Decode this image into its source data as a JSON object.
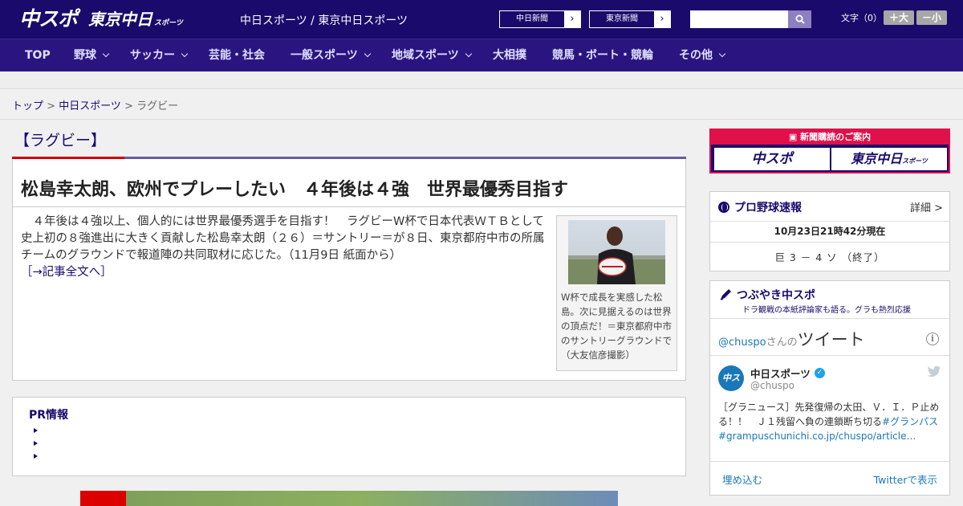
{
  "header": {
    "logo_chuspo": "中スポ",
    "logo_tokyo": "東京中日",
    "logo_tokyo_small": "スポーツ",
    "site_title": "中日スポーツ / 東京中日スポーツ",
    "paper_buttons": [
      {
        "label": "中日新聞",
        "arrow": "›"
      },
      {
        "label": "東京新聞",
        "arrow": "›"
      }
    ],
    "search_placeholder": "",
    "font_size_label": "文字（0）",
    "font_larger": "＋大",
    "font_smaller": "－小"
  },
  "nav": {
    "items": [
      {
        "label": "TOP",
        "dropdown": false
      },
      {
        "label": "野球",
        "dropdown": true
      },
      {
        "label": "サッカー",
        "dropdown": true
      },
      {
        "label": "芸能・社会",
        "dropdown": false
      },
      {
        "label": "一般スポーツ",
        "dropdown": true
      },
      {
        "label": "地域スポーツ",
        "dropdown": true
      },
      {
        "label": "大相撲",
        "dropdown": false
      },
      {
        "label": "競馬・ボート・競輪",
        "dropdown": false
      },
      {
        "label": "その他",
        "dropdown": true
      }
    ]
  },
  "breadcrumb": {
    "top": "トップ",
    "sep1": " > ",
    "section": "中日スポーツ",
    "sep2": " > ",
    "current": "ラグビー"
  },
  "category": {
    "title": "【ラグビー】"
  },
  "article": {
    "headline": "松島幸太朗、欧州でプレーしたい　４年後は４強　世界最優秀目指す",
    "body": "　４年後は４強以上、個人的には世界最優秀選手を目指す！　ラグビーW杯で日本代表ＷＴＢとして史上初の８強進出に大きく貢献した松島幸太朗（２６）＝サントリー＝が８日、東京都府中市の所属チームのグラウンドで報道陣の共同取材に応じた。（11月9日 紙面から）",
    "more_link": "［→記事全文へ］",
    "photo_caption": "W杯で成長を実感した松島。次に見据えるのは世界の頂点だ！＝東京都府中市のサントリーグラウンドで（大友信彦撮影）"
  },
  "pr": {
    "title": "PR情報"
  },
  "sidebar": {
    "subscription_title": "新聞購読のご案内",
    "subscription_logo_left": "中スポ",
    "subscription_logo_right": "東京中日",
    "subscription_logo_right_small": "スポーツ",
    "baseball": {
      "title": "プロ野球速報",
      "detail": "詳細 >",
      "time": "10月23日21時42分現在",
      "score": "巨 3 － 4 ソ （終了）"
    },
    "tweets": {
      "title": "つぶやき中スポ",
      "subtitle": "ドラ観戦の本紙評論家も語る。グラも熱烈応援",
      "handle_prefix": "@chuspo",
      "handle_suffix": "さんの",
      "tweets_word": "ツイート",
      "account_name": "中日スポーツ",
      "account_handle": "@chuspo",
      "avatar_text": "中スポ",
      "tweet_text": "［グラニュース］先発復帰の太田、Ｖ．Ｉ．Ｐ止める！！　Ｊ１残留へ負の連鎖断ち切る",
      "tweet_hashtag": "#グランパス",
      "tweet_link": "#grampuschunichi.co.jp/chuspo/article…",
      "embed": "埋め込む",
      "view_on_twitter": "Twitterで表示"
    }
  },
  "colors": {
    "brand": "#1a0a6b",
    "nav": "#2a1580",
    "accent_red": "#e0104b",
    "twitter_blue": "#1a78b8"
  }
}
